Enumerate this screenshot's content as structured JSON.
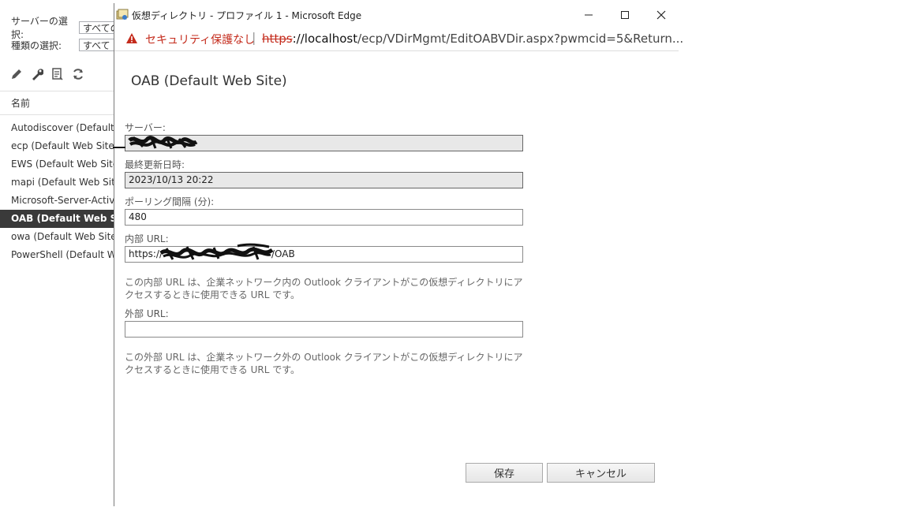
{
  "background": {
    "server_select_label": "サーバーの選択:",
    "server_select_value": "すべての",
    "type_select_label": "種類の選択:",
    "type_select_value": "すべて",
    "toolbar_icons": [
      "pencil-icon",
      "wrench-icon",
      "reset-icon",
      "refresh-icon"
    ],
    "list_header": "名前",
    "list_items": [
      "Autodiscover (Default Web Site)",
      "ecp (Default Web Site)",
      "EWS (Default Web Site)",
      "mapi (Default Web Site)",
      "Microsoft-Server-ActiveSync",
      "OAB (Default Web Site)",
      "owa (Default Web Site)",
      "PowerShell (Default Web Site)"
    ],
    "selected_index": 5
  },
  "window": {
    "title": "仮想ディレクトリ - プロファイル 1 - Microsoft Edge",
    "controls": {
      "minimize": "—",
      "maximize": "☐",
      "close": "✕"
    },
    "address": {
      "security_text": "セキュリティ保護なし",
      "separator": "|",
      "scheme": "https",
      "host_part": "://localhost",
      "path_part": "/ecp/VDirMgmt/EditOABVDir.aspx?pwmcid=5&Return..."
    }
  },
  "form": {
    "title": "OAB (Default Web Site)",
    "server_label": "サーバー:",
    "server_value": "",
    "last_modified_label": "最終更新日時:",
    "last_modified_value": "2023/10/13 20:22",
    "polling_label": "ポーリング間隔 (分):",
    "polling_value": "480",
    "internal_url_label": "内部 URL:",
    "internal_url_prefix": "https://",
    "internal_url_suffix": "/OAB",
    "internal_note": "この内部 URL は、企業ネットワーク内の Outlook クライアントがこの仮想ディレクトリにアクセスするときに使用できる URL です。",
    "external_url_label": "外部 URL:",
    "external_url_value": "",
    "external_note": "この外部 URL は、企業ネットワーク外の Outlook クライアントがこの仮想ディレクトリにアクセスするときに使用できる URL です。",
    "save_label": "保存",
    "cancel_label": "キャンセル"
  },
  "colors": {
    "selected_row_bg": "#3a3a3a",
    "insecure_red": "#c42b1c",
    "readonly_field_bg": "#e8e8e8"
  }
}
